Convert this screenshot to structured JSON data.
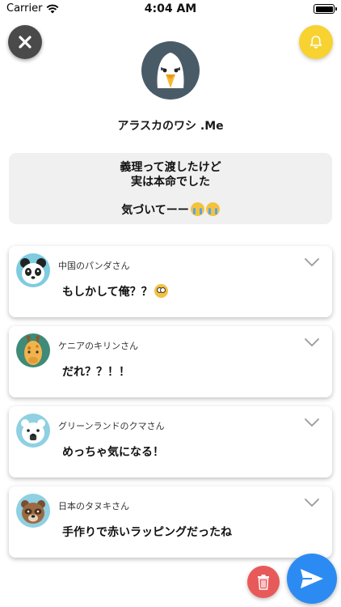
{
  "status_bar": {
    "carrier": "Carrier",
    "time": "4:04 AM"
  },
  "header": {
    "close_icon": "close-icon",
    "bell_icon": "bell-icon"
  },
  "profile": {
    "name": "アラスカのワシ .Me",
    "avatar": "eagle-avatar"
  },
  "message": {
    "line1": "義理って渡したけど",
    "line2": "実は本命でした",
    "line3": "気づいてーー",
    "emoji": "crying-face-emoji"
  },
  "comments": [
    {
      "user": "中国のパンダさん",
      "text": "もしかして俺？？",
      "avatar": "panda-avatar",
      "emoji": "flushed-face-emoji"
    },
    {
      "user": "ケニアのキリンさん",
      "text": "だれ？？！！",
      "avatar": "giraffe-avatar"
    },
    {
      "user": "グリーンランドのクマさん",
      "text": "めっちゃ気になる！",
      "avatar": "polar-bear-avatar"
    },
    {
      "user": "日本のタヌキさん",
      "text": "手作りで赤いラッピングだったね",
      "avatar": "tanuki-avatar"
    }
  ],
  "actions": {
    "delete_icon": "trash-icon",
    "send_icon": "paper-plane-icon"
  },
  "colors": {
    "close": "#4a4a4a",
    "bell": "#f7d231",
    "delete": "#e85a5a",
    "send": "#2b8bf2",
    "message_bg": "#f0f0f0"
  }
}
